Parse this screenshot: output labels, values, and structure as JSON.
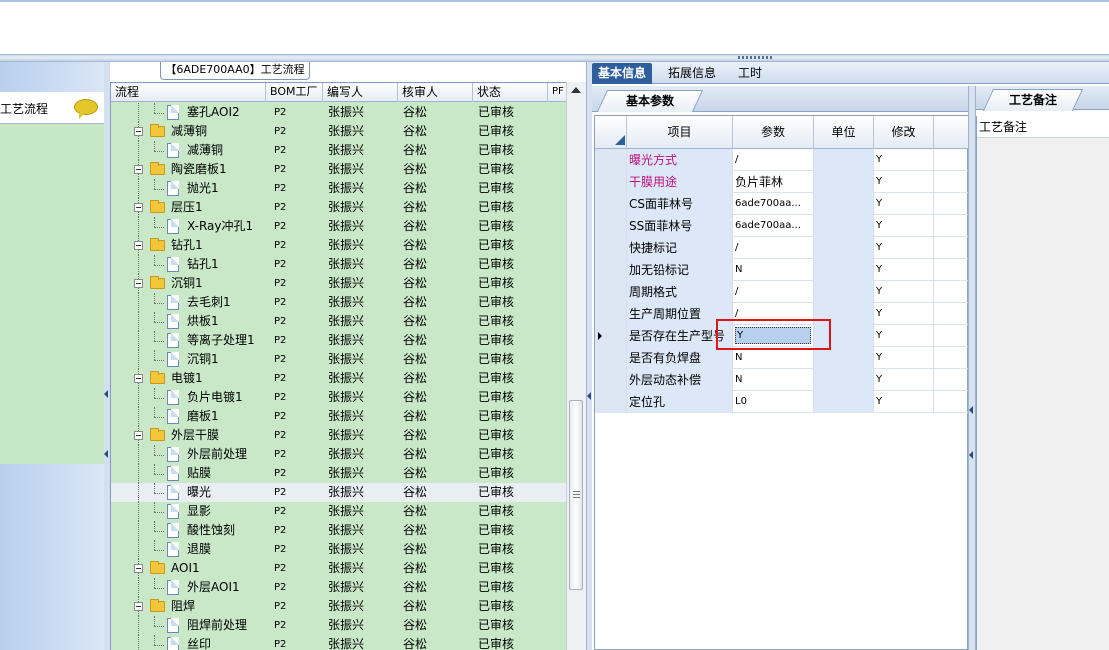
{
  "left_panel": {
    "title": "工艺流程",
    "icon": "comment-bubble-icon"
  },
  "process_tab": "【6ADE700AA0】工艺流程",
  "tree": {
    "columns": [
      "流程",
      "BOM工厂",
      "编写人",
      "核审人",
      "状态",
      "PF"
    ],
    "rows": [
      {
        "name": "塞孔AOI2",
        "type": "doc",
        "level": 2,
        "bom": "P2",
        "writer": "张振兴",
        "reviewer": "谷松",
        "status": "已审核"
      },
      {
        "name": "减薄铜",
        "type": "folder",
        "level": 1,
        "bom": "P2",
        "writer": "张振兴",
        "reviewer": "谷松",
        "status": "已审核"
      },
      {
        "name": "减薄铜",
        "type": "doc",
        "level": 2,
        "bom": "P2",
        "writer": "张振兴",
        "reviewer": "谷松",
        "status": "已审核"
      },
      {
        "name": "陶瓷磨板1",
        "type": "folder",
        "level": 1,
        "bom": "P2",
        "writer": "张振兴",
        "reviewer": "谷松",
        "status": "已审核"
      },
      {
        "name": "抛光1",
        "type": "doc",
        "level": 2,
        "bom": "P2",
        "writer": "张振兴",
        "reviewer": "谷松",
        "status": "已审核"
      },
      {
        "name": "层压1",
        "type": "folder",
        "level": 1,
        "bom": "P2",
        "writer": "张振兴",
        "reviewer": "谷松",
        "status": "已审核"
      },
      {
        "name": "X-Ray冲孔1",
        "type": "doc",
        "level": 2,
        "bom": "P2",
        "writer": "张振兴",
        "reviewer": "谷松",
        "status": "已审核"
      },
      {
        "name": "钻孔1",
        "type": "folder",
        "level": 1,
        "bom": "P2",
        "writer": "张振兴",
        "reviewer": "谷松",
        "status": "已审核"
      },
      {
        "name": "钻孔1",
        "type": "doc",
        "level": 2,
        "bom": "P2",
        "writer": "张振兴",
        "reviewer": "谷松",
        "status": "已审核"
      },
      {
        "name": "沉铜1",
        "type": "folder",
        "level": 1,
        "bom": "P2",
        "writer": "张振兴",
        "reviewer": "谷松",
        "status": "已审核"
      },
      {
        "name": "去毛刺1",
        "type": "doc",
        "level": 2,
        "bom": "P2",
        "writer": "张振兴",
        "reviewer": "谷松",
        "status": "已审核"
      },
      {
        "name": "烘板1",
        "type": "doc",
        "level": 2,
        "bom": "P2",
        "writer": "张振兴",
        "reviewer": "谷松",
        "status": "已审核"
      },
      {
        "name": "等离子处理1",
        "type": "doc",
        "level": 2,
        "bom": "P2",
        "writer": "张振兴",
        "reviewer": "谷松",
        "status": "已审核"
      },
      {
        "name": "沉铜1",
        "type": "doc",
        "level": 2,
        "bom": "P2",
        "writer": "张振兴",
        "reviewer": "谷松",
        "status": "已审核"
      },
      {
        "name": "电镀1",
        "type": "folder",
        "level": 1,
        "bom": "P2",
        "writer": "张振兴",
        "reviewer": "谷松",
        "status": "已审核"
      },
      {
        "name": "负片电镀1",
        "type": "doc",
        "level": 2,
        "bom": "P2",
        "writer": "张振兴",
        "reviewer": "谷松",
        "status": "已审核"
      },
      {
        "name": "磨板1",
        "type": "doc",
        "level": 2,
        "bom": "P2",
        "writer": "张振兴",
        "reviewer": "谷松",
        "status": "已审核"
      },
      {
        "name": "外层干膜",
        "type": "folder",
        "level": 1,
        "bom": "P2",
        "writer": "张振兴",
        "reviewer": "谷松",
        "status": "已审核"
      },
      {
        "name": "外层前处理",
        "type": "doc",
        "level": 2,
        "bom": "P2",
        "writer": "张振兴",
        "reviewer": "谷松",
        "status": "已审核"
      },
      {
        "name": "贴膜",
        "type": "doc",
        "level": 2,
        "bom": "P2",
        "writer": "张振兴",
        "reviewer": "谷松",
        "status": "已审核"
      },
      {
        "name": "曝光",
        "type": "doc",
        "level": 2,
        "bom": "P2",
        "writer": "张振兴",
        "reviewer": "谷松",
        "status": "已审核",
        "selected": true
      },
      {
        "name": "显影",
        "type": "doc",
        "level": 2,
        "bom": "P2",
        "writer": "张振兴",
        "reviewer": "谷松",
        "status": "已审核"
      },
      {
        "name": "酸性蚀刻",
        "type": "doc",
        "level": 2,
        "bom": "P2",
        "writer": "张振兴",
        "reviewer": "谷松",
        "status": "已审核"
      },
      {
        "name": "退膜",
        "type": "doc",
        "level": 2,
        "bom": "P2",
        "writer": "张振兴",
        "reviewer": "谷松",
        "status": "已审核"
      },
      {
        "name": "AOI1",
        "type": "folder",
        "level": 1,
        "bom": "P2",
        "writer": "张振兴",
        "reviewer": "谷松",
        "status": "已审核"
      },
      {
        "name": "外层AOI1",
        "type": "doc",
        "level": 2,
        "bom": "P2",
        "writer": "张振兴",
        "reviewer": "谷松",
        "status": "已审核"
      },
      {
        "name": "阻焊",
        "type": "folder",
        "level": 1,
        "bom": "P2",
        "writer": "张振兴",
        "reviewer": "谷松",
        "status": "已审核"
      },
      {
        "name": "阻焊前处理",
        "type": "doc",
        "level": 2,
        "bom": "P2",
        "writer": "张振兴",
        "reviewer": "谷松",
        "status": "已审核"
      },
      {
        "name": "丝印",
        "type": "doc",
        "level": 2,
        "bom": "P2",
        "writer": "张振兴",
        "reviewer": "谷松",
        "status": "已审核"
      }
    ]
  },
  "right_tabs": [
    "基本信息",
    "拓展信息",
    "工时"
  ],
  "basic_params_tab": "基本参数",
  "params": {
    "columns": [
      "项目",
      "参数",
      "单位",
      "修改"
    ],
    "rows": [
      {
        "item": "曝光方式",
        "param": "/",
        "unit": "",
        "modify": "Y",
        "pink": true
      },
      {
        "item": "干膜用途",
        "param": "负片菲林",
        "unit": "",
        "modify": "Y",
        "pink": true
      },
      {
        "item": "CS面菲林号",
        "param": "6ade700aa...",
        "unit": "",
        "modify": "Y"
      },
      {
        "item": "SS面菲林号",
        "param": "6ade700aa...",
        "unit": "",
        "modify": "Y"
      },
      {
        "item": "快捷标记",
        "param": "/",
        "unit": "",
        "modify": "Y"
      },
      {
        "item": "加无铅标记",
        "param": "N",
        "unit": "",
        "modify": "Y"
      },
      {
        "item": "周期格式",
        "param": "/",
        "unit": "",
        "modify": "Y"
      },
      {
        "item": "生产周期位置",
        "param": "/",
        "unit": "",
        "modify": "Y"
      },
      {
        "item": "是否存在生产型号",
        "param": "Y",
        "unit": "",
        "modify": "Y",
        "editing": true
      },
      {
        "item": "是否有负焊盘",
        "param": "N",
        "unit": "",
        "modify": "Y"
      },
      {
        "item": "外层动态补偿",
        "param": "N",
        "unit": "",
        "modify": "Y"
      },
      {
        "item": "定位孔",
        "param": "L0",
        "unit": "",
        "modify": "Y"
      }
    ]
  },
  "notes": {
    "tab": "工艺备注",
    "header": "工艺备注"
  },
  "colors": {
    "tree_bg": "#c8e8c8",
    "tab_active": "#2f5e9e",
    "pink_text": "#c0107e",
    "highlight_red": "#e01616"
  }
}
